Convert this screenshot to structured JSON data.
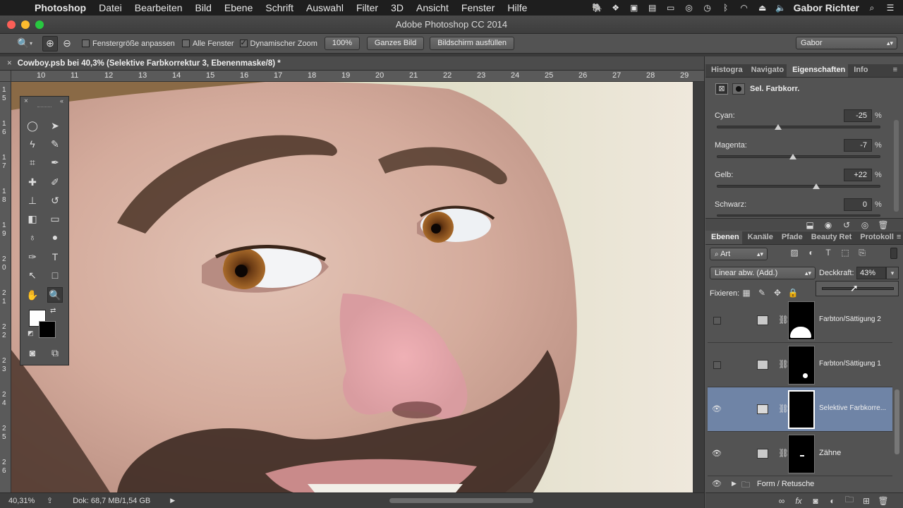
{
  "menubar": {
    "app": "Photoshop",
    "items": [
      "Datei",
      "Bearbeiten",
      "Bild",
      "Ebene",
      "Schrift",
      "Auswahl",
      "Filter",
      "3D",
      "Ansicht",
      "Fenster",
      "Hilfe"
    ],
    "user": "Gabor Richter"
  },
  "window": {
    "title": "Adobe Photoshop CC 2014"
  },
  "options": {
    "fit_window": "Fenstergröße anpassen",
    "all_windows": "Alle Fenster",
    "dynamic_zoom": "Dynamischer Zoom",
    "zoom_btn": "100%",
    "fit_btn": "Ganzes Bild",
    "fill_btn": "Bildschirm ausfüllen",
    "workspace": "Gabor"
  },
  "document": {
    "tab_title": "Cowboy.psb bei 40,3% (Selektive Farbkorrektur 3, Ebenenmaske/8) *"
  },
  "rulers": {
    "h": [
      "10",
      "11",
      "12",
      "13",
      "14",
      "15",
      "16",
      "17",
      "18",
      "19",
      "20",
      "21",
      "22",
      "23",
      "24",
      "25",
      "26",
      "27",
      "28",
      "29"
    ],
    "v": [
      "1\n5",
      "1\n6",
      "1\n7",
      "1\n8",
      "1\n9",
      "2\n0",
      "2\n1",
      "2\n2",
      "2\n3",
      "2\n4",
      "2\n5",
      "2\n6"
    ]
  },
  "status": {
    "zoom": "40,31%",
    "doc": "Dok: 68,7 MB/1,54 GB"
  },
  "properties": {
    "tabs": [
      "Histogra",
      "Navigato",
      "Eigenschaften",
      "Info"
    ],
    "title": "Sel. Farbkorr.",
    "sliders": [
      {
        "label": "Cyan:",
        "value": "-25",
        "unit": "%",
        "pos": 0.375
      },
      {
        "label": "Magenta:",
        "value": "-7",
        "unit": "%",
        "pos": 0.465
      },
      {
        "label": "Gelb:",
        "value": "+22",
        "unit": "%",
        "pos": 0.61
      },
      {
        "label": "Schwarz:",
        "value": "0",
        "unit": "%",
        "pos": 0.5
      }
    ]
  },
  "layers": {
    "tabs": [
      "Ebenen",
      "Kanäle",
      "Pfade",
      "Beauty Ret",
      "Protokoll"
    ],
    "filter": "Art",
    "blend_mode": "Linear abw. (Add.)",
    "opacity_label": "Deckkraft:",
    "opacity_value": "43%",
    "fix_label": "Fixieren:",
    "items": [
      {
        "name": "Farbton/Sättigung 2",
        "visible": false,
        "selected": false
      },
      {
        "name": "Farbton/Sättigung 1",
        "visible": false,
        "selected": false
      },
      {
        "name": "Selektive Farbkorre...",
        "visible": true,
        "selected": true
      },
      {
        "name": "Zähne",
        "visible": true,
        "selected": false
      }
    ],
    "group": "Form / Retusche"
  }
}
